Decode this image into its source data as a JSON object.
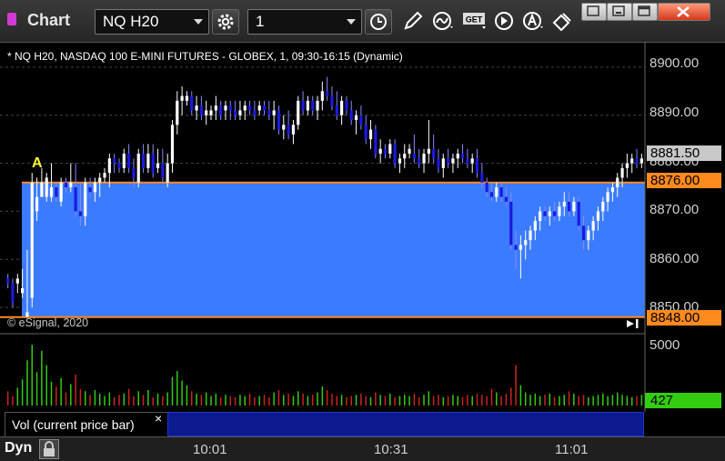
{
  "toolbar": {
    "title": "Chart",
    "symbol": "NQ H20",
    "interval": "1",
    "icons": [
      "settings-gear-icon",
      "clock-icon",
      "pencil-draw-icon",
      "study-wave-icon",
      "get-data-icon",
      "play-icon",
      "alert-a-icon",
      "clear-drawings-icon"
    ]
  },
  "window": {
    "controls": [
      "restore",
      "minimize",
      "maximize",
      "close"
    ]
  },
  "chart": {
    "info": "* NQ H20, NASDAQ 100 E-MINI FUTURES - GLOBEX, 1, 09:30-16:15 (Dynamic)",
    "copyright": "© eSignal, 2020",
    "marker": "A",
    "price_ticks": [
      "8900.00",
      "8890.00",
      "8880.00",
      "8870.00",
      "8860.00",
      "8850.00"
    ],
    "last_price": "8881.50",
    "zone_top": "8876.00",
    "zone_bottom": "8848.00",
    "volume_tick": "5000",
    "volume_last": "427",
    "volume_legend": "Vol (current price bar)",
    "close_mark": "×",
    "time_ticks": [
      "10:01",
      "10:31",
      "11:01"
    ],
    "dyn_label": "Dyn"
  },
  "colors": {
    "up": "#ffffff",
    "down": "#1a1ae0",
    "zone": "#3b7bff",
    "zone_line": "#ff8a1e",
    "vol_up": "#33cc11",
    "vol_down": "#cc2222"
  },
  "chart_data": {
    "type": "candlestick",
    "ylim": [
      8847,
      8903
    ],
    "zone": [
      8848,
      8876
    ],
    "ohlc": [
      [
        8856,
        8857,
        8854,
        8855
      ],
      [
        8855,
        8856,
        8850,
        8851
      ],
      [
        8855,
        8857,
        8853,
        8856
      ],
      [
        8853,
        8858,
        8852,
        8854
      ],
      [
        8848,
        8862,
        8848,
        8849
      ],
      [
        8852,
        8878,
        8850,
        8876
      ],
      [
        8870,
        8877,
        8868,
        8873
      ],
      [
        8873,
        8879,
        8873,
        8876
      ],
      [
        8873,
        8878,
        8872,
        8877
      ],
      [
        8873,
        8880,
        8872,
        8875
      ],
      [
        8875,
        8876,
        8872,
        8873
      ],
      [
        8872,
        8877,
        8871,
        8876
      ],
      [
        8876,
        8877,
        8874,
        8875
      ],
      [
        8875,
        8880,
        8874,
        8876
      ],
      [
        8875,
        8880,
        8869,
        8870
      ],
      [
        8870,
        8876,
        8867,
        8869
      ],
      [
        8869,
        8877,
        8867,
        8876
      ],
      [
        8875,
        8877,
        8873,
        8874
      ],
      [
        8874,
        8877,
        8872,
        8876
      ],
      [
        8876,
        8878,
        8873,
        8877
      ],
      [
        8877,
        8879,
        8876,
        8878
      ],
      [
        8878,
        8882,
        8875,
        8881
      ],
      [
        8881,
        8882,
        8878,
        8880
      ],
      [
        8880,
        8881,
        8878,
        8879
      ],
      [
        8879,
        8883,
        8878,
        8882
      ],
      [
        8882,
        8884,
        8878,
        8879
      ],
      [
        8879,
        8881,
        8875,
        8877
      ],
      [
        8876,
        8883,
        8875,
        8882
      ],
      [
        8882,
        8884,
        8878,
        8879
      ],
      [
        8879,
        8884,
        8878,
        8882
      ],
      [
        8882,
        8884,
        8877,
        8878
      ],
      [
        8879,
        8883,
        8878,
        8880
      ],
      [
        8880,
        8883,
        8876,
        8877
      ],
      [
        8876,
        8882,
        8875,
        8880
      ],
      [
        8880,
        8889,
        8878,
        8888
      ],
      [
        8888,
        8895,
        8886,
        8893
      ],
      [
        8893,
        8896,
        8890,
        8894
      ],
      [
        8893,
        8895,
        8892,
        8894
      ],
      [
        8894,
        8895,
        8890,
        8891
      ],
      [
        8891,
        8894,
        8889,
        8892
      ],
      [
        8892,
        8894,
        8889,
        8890
      ],
      [
        8890,
        8893,
        8888,
        8891
      ],
      [
        8890,
        8892,
        8889,
        8891
      ],
      [
        8891,
        8894,
        8889,
        8892
      ],
      [
        8892,
        8893,
        8889,
        8890
      ],
      [
        8891,
        8893,
        8889,
        8892
      ],
      [
        8892,
        8893,
        8889,
        8891
      ],
      [
        8891,
        8893,
        8889,
        8890
      ],
      [
        8890,
        8893,
        8889,
        8891
      ],
      [
        8891,
        8893,
        8889,
        8892
      ],
      [
        8892,
        8893,
        8890,
        8891
      ],
      [
        8891,
        8893,
        8889,
        8890
      ],
      [
        8891,
        8893,
        8890,
        8892
      ],
      [
        8892,
        8893,
        8890,
        8891
      ],
      [
        8891,
        8893,
        8889,
        8890
      ],
      [
        8890,
        8893,
        8887,
        8891
      ],
      [
        8891,
        8892,
        8886,
        8887
      ],
      [
        8887,
        8890,
        8885,
        8888
      ],
      [
        8888,
        8891,
        8885,
        8886
      ],
      [
        8886,
        8889,
        8884,
        8888
      ],
      [
        8888,
        8894,
        8887,
        8893
      ],
      [
        8893,
        8895,
        8890,
        8891
      ],
      [
        8891,
        8894,
        8890,
        8893
      ],
      [
        8893,
        8894,
        8890,
        8891
      ],
      [
        8891,
        8894,
        8889,
        8893
      ],
      [
        8893,
        8897,
        8891,
        8895
      ],
      [
        8895,
        8898,
        8893,
        8894
      ],
      [
        8894,
        8896,
        8891,
        8892
      ],
      [
        8892,
        8895,
        8889,
        8890
      ],
      [
        8890,
        8894,
        8888,
        8893
      ],
      [
        8893,
        8894,
        8890,
        8891
      ],
      [
        8891,
        8893,
        8888,
        8889
      ],
      [
        8889,
        8891,
        8886,
        8890
      ],
      [
        8890,
        8892,
        8887,
        8888
      ],
      [
        8888,
        8890,
        8884,
        8885
      ],
      [
        8885,
        8889,
        8883,
        8887
      ],
      [
        8887,
        8888,
        8881,
        8882
      ],
      [
        8882,
        8885,
        8880,
        8883
      ],
      [
        8883,
        8884,
        8881,
        8882
      ],
      [
        8882,
        8885,
        8881,
        8884
      ],
      [
        8884,
        8885,
        8879,
        8880
      ],
      [
        8880,
        8882,
        8878,
        8881
      ],
      [
        8881,
        8884,
        8879,
        8882
      ],
      [
        8882,
        8884,
        8881,
        8883
      ],
      [
        8882,
        8886,
        8880,
        8881
      ],
      [
        8881,
        8883,
        8879,
        8880
      ],
      [
        8880,
        8883,
        8878,
        8882
      ],
      [
        8882,
        8889,
        8880,
        8883
      ],
      [
        8883,
        8886,
        8880,
        8881
      ],
      [
        8881,
        8883,
        8878,
        8879
      ],
      [
        8879,
        8882,
        8877,
        8881
      ],
      [
        8881,
        8883,
        8879,
        8880
      ],
      [
        8880,
        8882,
        8878,
        8881
      ],
      [
        8881,
        8883,
        8879,
        8882
      ],
      [
        8882,
        8884,
        8880,
        8881
      ],
      [
        8881,
        8883,
        8879,
        8880
      ],
      [
        8880,
        8882,
        8878,
        8881
      ],
      [
        8881,
        8883,
        8877,
        8878
      ],
      [
        8878,
        8880,
        8875,
        8876
      ],
      [
        8876,
        8877,
        8873,
        8874
      ],
      [
        8874,
        8876,
        8872,
        8873
      ],
      [
        8873,
        8876,
        8872,
        8875
      ],
      [
        8875,
        8876,
        8872,
        8873
      ],
      [
        8873,
        8875,
        8871,
        8872
      ],
      [
        8872,
        8874,
        8862,
        8863
      ],
      [
        8863,
        8866,
        8858,
        8862
      ],
      [
        8862,
        8865,
        8856,
        8863
      ],
      [
        8863,
        8866,
        8860,
        8864
      ],
      [
        8864,
        8867,
        8862,
        8866
      ],
      [
        8866,
        8869,
        8864,
        8868
      ],
      [
        8868,
        8871,
        8866,
        8870
      ],
      [
        8870,
        8871,
        8868,
        8869
      ],
      [
        8869,
        8871,
        8867,
        8870
      ],
      [
        8870,
        8872,
        8868,
        8869
      ],
      [
        8869,
        8872,
        8868,
        8871
      ],
      [
        8871,
        8874,
        8869,
        8872
      ],
      [
        8872,
        8874,
        8869,
        8870
      ],
      [
        8870,
        8873,
        8869,
        8872
      ],
      [
        8872,
        8873,
        8866,
        8867
      ],
      [
        8867,
        8869,
        8862,
        8864
      ],
      [
        8864,
        8867,
        8862,
        8866
      ],
      [
        8866,
        8869,
        8864,
        8868
      ],
      [
        8868,
        8871,
        8866,
        8870
      ],
      [
        8870,
        8873,
        8868,
        8872
      ],
      [
        8872,
        8875,
        8870,
        8874
      ],
      [
        8874,
        8876,
        8872,
        8875
      ],
      [
        8875,
        8878,
        8873,
        8877
      ],
      [
        8877,
        8880,
        8875,
        8879
      ],
      [
        8879,
        8882,
        8877,
        8880
      ],
      [
        8880,
        8882,
        8878,
        8881
      ],
      [
        8881,
        8883,
        8879,
        8880
      ],
      [
        8880,
        8882,
        8879,
        8881
      ]
    ],
    "volume": [
      1.2,
      0.8,
      1.5,
      2.2,
      3.8,
      5.1,
      2.8,
      4.6,
      3.4,
      2.0,
      1.6,
      2.3,
      1.1,
      1.8,
      2.6,
      1.4,
      1.2,
      0.9,
      1.3,
      1.0,
      0.8,
      1.1,
      0.7,
      0.9,
      1.0,
      1.4,
      0.8,
      1.2,
      0.9,
      1.3,
      0.7,
      1.0,
      0.8,
      1.1,
      2.4,
      2.9,
      2.1,
      1.7,
      1.2,
      1.0,
      0.9,
      1.1,
      0.8,
      1.0,
      0.7,
      0.9,
      0.8,
      0.7,
      0.9,
      0.8,
      1.0,
      0.7,
      0.8,
      0.9,
      0.7,
      1.1,
      1.3,
      0.9,
      1.0,
      0.8,
      1.2,
      1.0,
      0.8,
      0.9,
      1.1,
      1.6,
      1.3,
      1.0,
      0.8,
      0.9,
      0.7,
      0.8,
      0.9,
      1.0,
      0.8,
      0.7,
      1.1,
      0.9,
      0.8,
      1.0,
      0.7,
      0.8,
      0.9,
      0.8,
      1.0,
      0.7,
      0.9,
      1.2,
      0.8,
      0.9,
      0.7,
      0.8,
      0.9,
      0.8,
      0.7,
      0.9,
      0.8,
      1.0,
      0.9,
      0.8,
      1.4,
      1.1,
      0.8,
      1.0,
      1.5,
      3.4,
      1.7,
      1.1,
      0.9,
      1.0,
      0.8,
      0.9,
      1.0,
      0.7,
      0.8,
      0.9,
      1.2,
      1.0,
      0.8,
      0.9,
      0.7,
      0.8,
      0.9,
      1.0,
      0.8,
      0.9,
      1.1,
      0.9,
      0.8,
      0.7,
      0.8,
      0.9
    ],
    "volume_max": 5.5
  }
}
